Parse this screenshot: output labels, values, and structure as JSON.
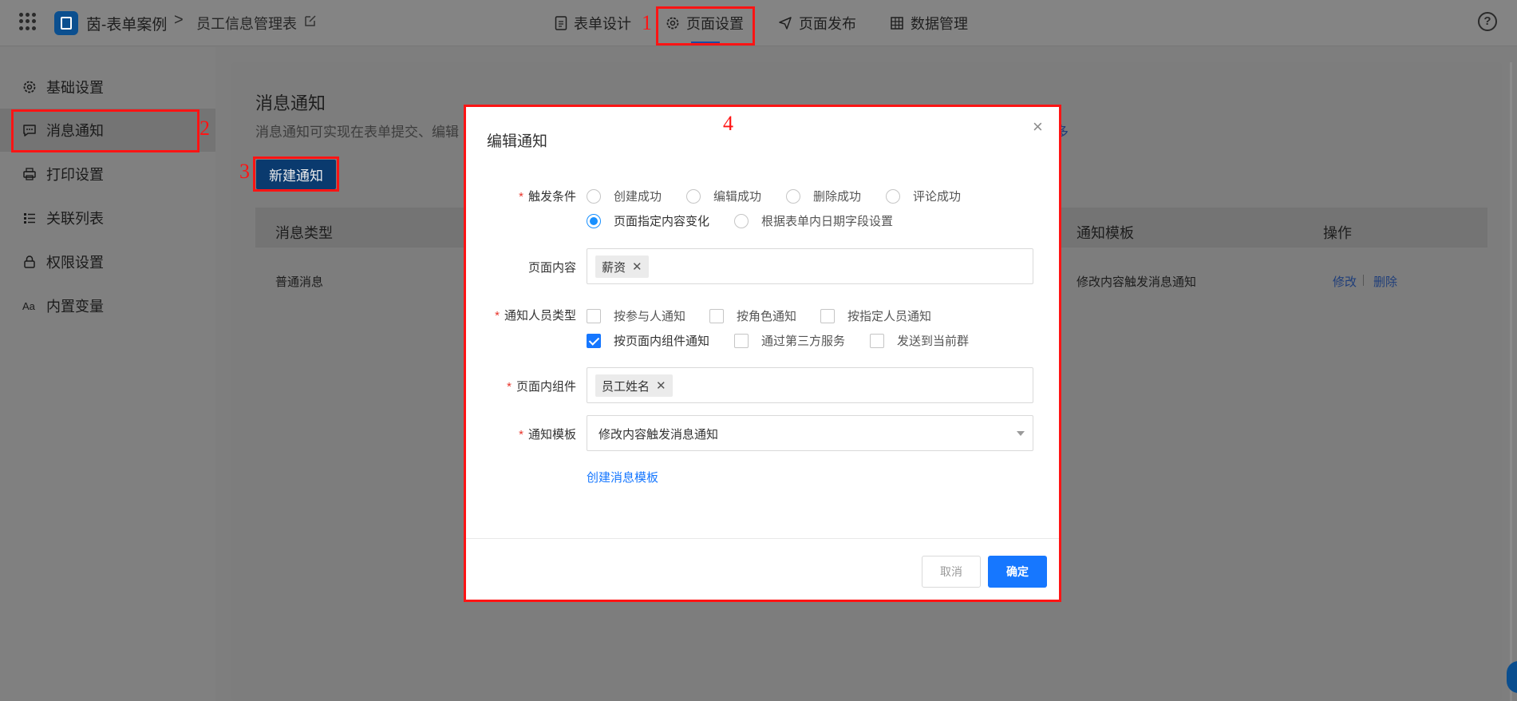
{
  "topbar": {
    "app_name": "茵-表单案例",
    "breadcrumb_sep": ">",
    "form_name": "员工信息管理表",
    "nav": [
      {
        "label": "表单设计",
        "icon": "document-icon"
      },
      {
        "label": "页面设置",
        "icon": "gear-icon"
      },
      {
        "label": "页面发布",
        "icon": "send-icon"
      },
      {
        "label": "数据管理",
        "icon": "table-icon"
      }
    ],
    "help": "?"
  },
  "sidebar": {
    "items": [
      {
        "label": "基础设置",
        "icon": "gear-icon"
      },
      {
        "label": "消息通知",
        "icon": "message-icon",
        "active": true
      },
      {
        "label": "打印设置",
        "icon": "printer-icon"
      },
      {
        "label": "关联列表",
        "icon": "list-icon"
      },
      {
        "label": "权限设置",
        "icon": "lock-icon"
      },
      {
        "label": "内置变量",
        "icon": "text-icon"
      }
    ]
  },
  "main": {
    "title": "消息通知",
    "desc": "消息通知可实现在表单提交、编辑",
    "more_link": "多",
    "new_button": "新建通知",
    "table": {
      "headers": [
        "消息类型",
        "通知模板",
        "操作"
      ],
      "rows": [
        {
          "type": "普通消息",
          "template": "修改内容触发消息通知",
          "edit": "修改",
          "delete": "删除"
        }
      ]
    }
  },
  "annotations": [
    "1",
    "2",
    "3",
    "4"
  ],
  "modal": {
    "title": "编辑通知",
    "close": "×",
    "trigger": {
      "label": "触发条件",
      "options": [
        "创建成功",
        "编辑成功",
        "删除成功",
        "评论成功",
        "页面指定内容变化",
        "根据表单内日期字段设置"
      ],
      "selected": "页面指定内容变化"
    },
    "page_content": {
      "label": "页面内容",
      "tags": [
        "薪资"
      ]
    },
    "notify_type": {
      "label": "通知人员类型",
      "options": [
        "按参与人通知",
        "按角色通知",
        "按指定人员通知",
        "按页面内组件通知",
        "通过第三方服务",
        "发送到当前群"
      ],
      "checked": [
        "按页面内组件通知"
      ]
    },
    "component": {
      "label": "页面内组件",
      "tags": [
        "员工姓名"
      ]
    },
    "template": {
      "label": "通知模板",
      "value": "修改内容触发消息通知"
    },
    "create_template_link": "创建消息模板",
    "cancel": "取消",
    "ok": "确定"
  },
  "colors": {
    "accent": "#1677ff",
    "annotation_red": "#ff1414",
    "required_star": "#e8342b"
  }
}
